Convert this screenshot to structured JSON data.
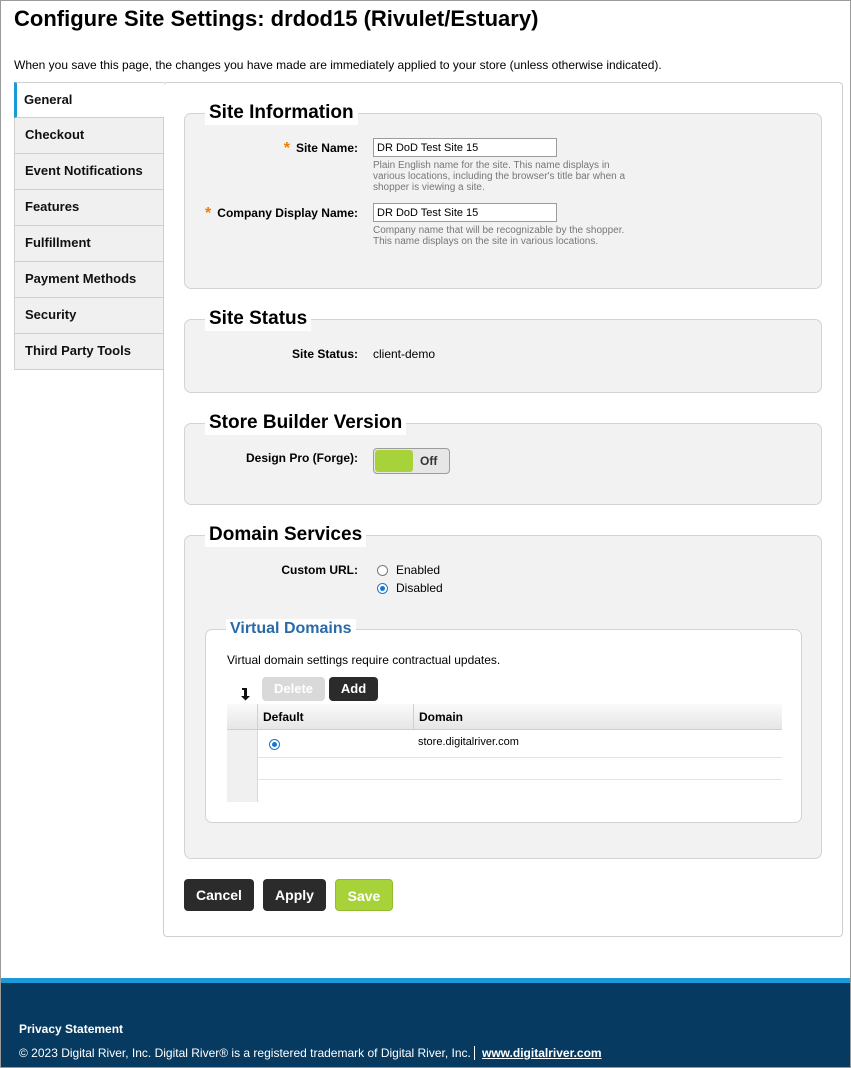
{
  "page": {
    "title": "Configure Site Settings: drdod15 (Rivulet/Estuary)",
    "intro": "When you save this page, the changes you have made are immediately applied to your store (unless otherwise indicated)."
  },
  "sidebar": {
    "items": [
      {
        "label": "General",
        "active": true
      },
      {
        "label": "Checkout"
      },
      {
        "label": "Event Notifications"
      },
      {
        "label": "Features"
      },
      {
        "label": "Fulfillment"
      },
      {
        "label": "Payment Methods"
      },
      {
        "label": "Security"
      },
      {
        "label": "Third Party Tools"
      }
    ]
  },
  "site_information": {
    "heading": "Site Information",
    "required_mark": "*",
    "site_name": {
      "label": "Site Name:",
      "value": "DR DoD Test Site 15",
      "help": "Plain English name for the site. This name displays in various locations, including the browser's title bar when a shopper is viewing a site."
    },
    "company_display_name": {
      "label": "Company Display Name:",
      "value": "DR DoD Test Site 15",
      "help": "Company name that will be recognizable by the shopper. This name displays on the site in various locations."
    }
  },
  "site_status": {
    "heading": "Site Status",
    "label": "Site Status:",
    "value": "client-demo"
  },
  "store_builder": {
    "heading": "Store Builder Version",
    "label": "Design Pro (Forge):",
    "toggle_text": "Off",
    "toggle_color": "#a8d23a"
  },
  "domain_services": {
    "heading": "Domain Services",
    "custom_url_label": "Custom URL:",
    "options": [
      {
        "label": "Enabled",
        "selected": false
      },
      {
        "label": "Disabled",
        "selected": true
      }
    ],
    "virtual_domains": {
      "heading": "Virtual Domains",
      "note": "Virtual domain settings require contractual updates.",
      "delete_label": "Delete",
      "add_label": "Add",
      "columns": [
        "Default",
        "Domain"
      ],
      "rows": [
        {
          "default": true,
          "domain": "store.digitalriver.com"
        }
      ]
    }
  },
  "actions": {
    "cancel": "Cancel",
    "apply": "Apply",
    "save": "Save"
  },
  "footer": {
    "privacy": "Privacy Statement",
    "copyright": "© 2023 Digital River, Inc. Digital River® is a registered trademark of Digital River, Inc.",
    "link": "www.digitalriver.com",
    "accent_color": "#1a9bd7",
    "background_color": "#073a60"
  }
}
